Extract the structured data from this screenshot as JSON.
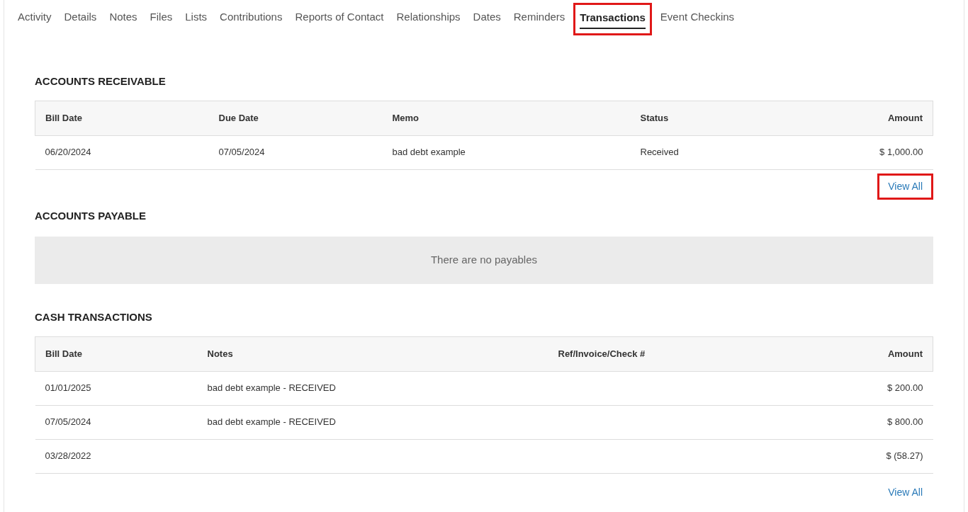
{
  "tabs": [
    {
      "label": "Activity",
      "selected": false,
      "highlighted": false
    },
    {
      "label": "Details",
      "selected": false,
      "highlighted": false
    },
    {
      "label": "Notes",
      "selected": false,
      "highlighted": false
    },
    {
      "label": "Files",
      "selected": false,
      "highlighted": false
    },
    {
      "label": "Lists",
      "selected": false,
      "highlighted": false
    },
    {
      "label": "Contributions",
      "selected": false,
      "highlighted": false
    },
    {
      "label": "Reports of Contact",
      "selected": false,
      "highlighted": false
    },
    {
      "label": "Relationships",
      "selected": false,
      "highlighted": false
    },
    {
      "label": "Dates",
      "selected": false,
      "highlighted": false
    },
    {
      "label": "Reminders",
      "selected": false,
      "highlighted": false
    },
    {
      "label": "Transactions",
      "selected": true,
      "highlighted": true
    },
    {
      "label": "Event Checkins",
      "selected": false,
      "highlighted": false
    }
  ],
  "accounts_receivable": {
    "title": "ACCOUNTS RECEIVABLE",
    "columns": [
      "Bill Date",
      "Due Date",
      "Memo",
      "Status",
      "Amount"
    ],
    "rows": [
      [
        "06/20/2024",
        "07/05/2024",
        "bad debt example",
        "Received",
        "$ 1,000.00"
      ]
    ],
    "view_all": {
      "label": "View All",
      "highlighted": true
    }
  },
  "accounts_payable": {
    "title": "ACCOUNTS PAYABLE",
    "empty_message": "There are no payables"
  },
  "cash_transactions": {
    "title": "CASH TRANSACTIONS",
    "columns": [
      "Bill Date",
      "Notes",
      "Ref/Invoice/Check #",
      "Amount"
    ],
    "rows": [
      [
        "01/01/2025",
        "bad debt example - RECEIVED",
        "",
        "$ 200.00"
      ],
      [
        "07/05/2024",
        "bad debt example - RECEIVED",
        "",
        "$ 800.00"
      ],
      [
        "03/28/2022",
        "",
        "",
        "$ (58.27)"
      ]
    ],
    "view_all": {
      "label": "View All",
      "highlighted": false
    }
  }
}
